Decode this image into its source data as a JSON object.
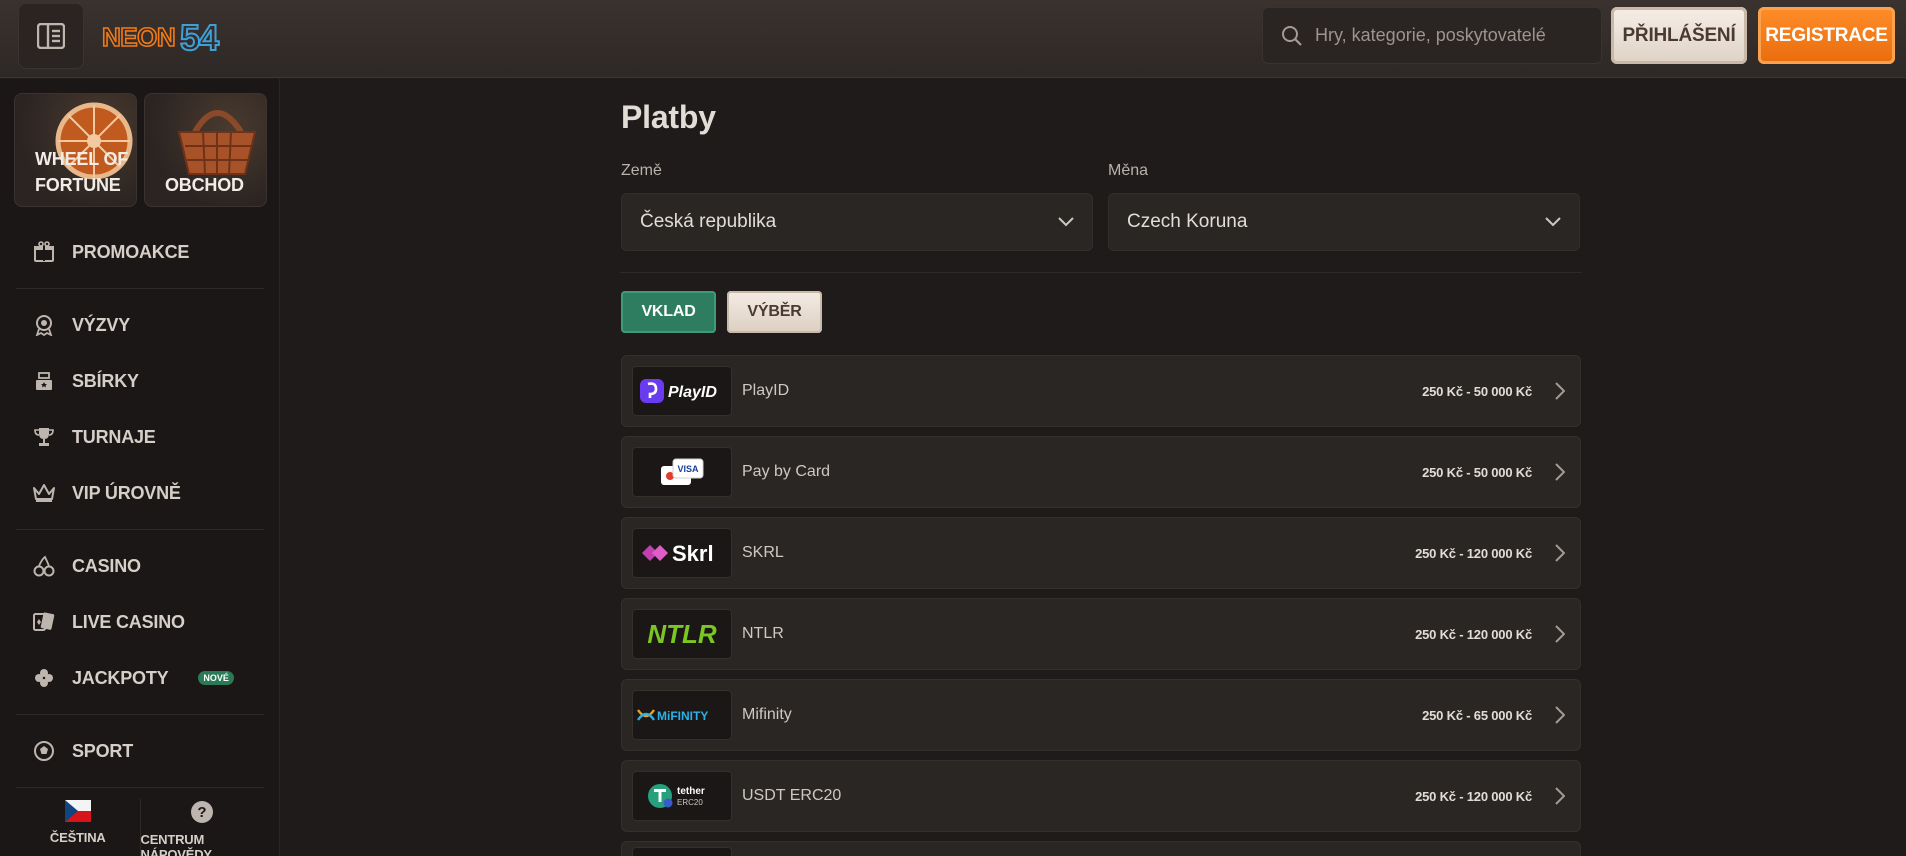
{
  "header": {
    "logo_text": "NEON54",
    "search_placeholder": "Hry, kategorie, poskytovatelé",
    "login_label": "PŘIHLÁŠENÍ",
    "register_label": "REGISTRACE"
  },
  "sidebar": {
    "cards": [
      {
        "label_line1": "WHEEL OF",
        "label_line2": "FORTUNE"
      },
      {
        "label": "OBCHOD"
      }
    ],
    "items": [
      {
        "label": "PROMOAKCE",
        "icon": "gift-icon"
      },
      {
        "label": "VÝZVY",
        "icon": "badge-icon"
      },
      {
        "label": "SBÍRKY",
        "icon": "collection-icon"
      },
      {
        "label": "TURNAJE",
        "icon": "trophy-icon"
      },
      {
        "label": "VIP ÚROVNĚ",
        "icon": "crown-icon"
      },
      {
        "label": "CASINO",
        "icon": "cherries-icon"
      },
      {
        "label": "LIVE CASINO",
        "icon": "cards-icon"
      },
      {
        "label": "JACKPOTY",
        "icon": "clover-icon",
        "badge": "NOVÉ"
      },
      {
        "label": "SPORT",
        "icon": "soccer-ball-icon"
      }
    ],
    "bottom": {
      "language": "ČEŠTINA",
      "help": "CENTRUM NÁPOVĚDY"
    }
  },
  "main": {
    "title": "Platby",
    "country_label": "Země",
    "country_value": "Česká republika",
    "currency_label": "Měna",
    "currency_value": "Czech Koruna",
    "tabs": [
      {
        "label": "VKLAD",
        "active": true
      },
      {
        "label": "VÝBĚR",
        "active": false
      }
    ],
    "methods": [
      {
        "name": "PlayID",
        "limit": "250 Kč - 50 000 Kč",
        "logo_text": "PlayID"
      },
      {
        "name": "Pay by Card",
        "limit": "250 Kč - 50 000 Kč",
        "logo_text": "VISA"
      },
      {
        "name": "SKRL",
        "limit": "250 Kč - 120 000 Kč",
        "logo_text": "Skrl"
      },
      {
        "name": "NTLR",
        "limit": "250 Kč - 120 000 Kč",
        "logo_text": "NTLR"
      },
      {
        "name": "Mifinity",
        "limit": "250 Kč - 65 000 Kč",
        "logo_text": "MiFINITY"
      },
      {
        "name": "USDT ERC20",
        "limit": "250 Kč - 120 000 Kč",
        "logo_text_1": "tether",
        "logo_text_2": "ERC20"
      }
    ]
  },
  "colors": {
    "accent_orange": "#f07a18",
    "accent_green": "#2e7d60",
    "background": "#1e1b1a"
  }
}
